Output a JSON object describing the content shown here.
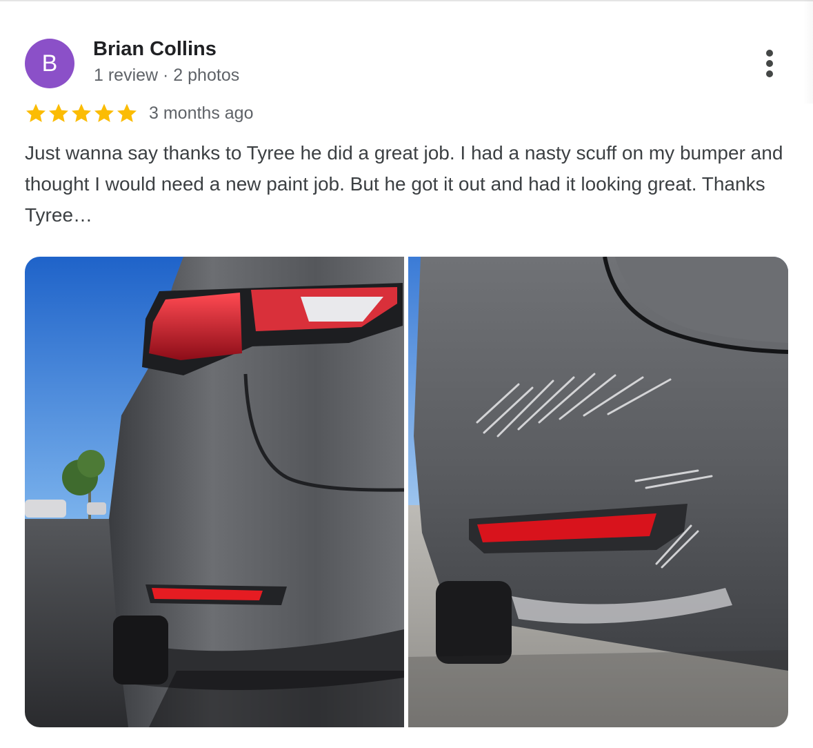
{
  "review": {
    "author_name": "Brian Collins",
    "avatar_letter": "B",
    "avatar_color": "#8b50c8",
    "author_meta": "1 review · 2 photos",
    "rating": 5,
    "rating_max": 5,
    "star_color": "#fbbc04",
    "time_ago": "3 months ago",
    "text": "Just wanna say thanks to Tyree he did a great job. I had a nasty scuff on my bumper and thought I would need a new paint job. But he got it out and had it looking great. Thanks Tyree…",
    "more_icon": "more-vert-icon",
    "photos": [
      {
        "subject": "car rear bumper, after repair"
      },
      {
        "subject": "car rear bumper with scuff damage"
      }
    ]
  }
}
